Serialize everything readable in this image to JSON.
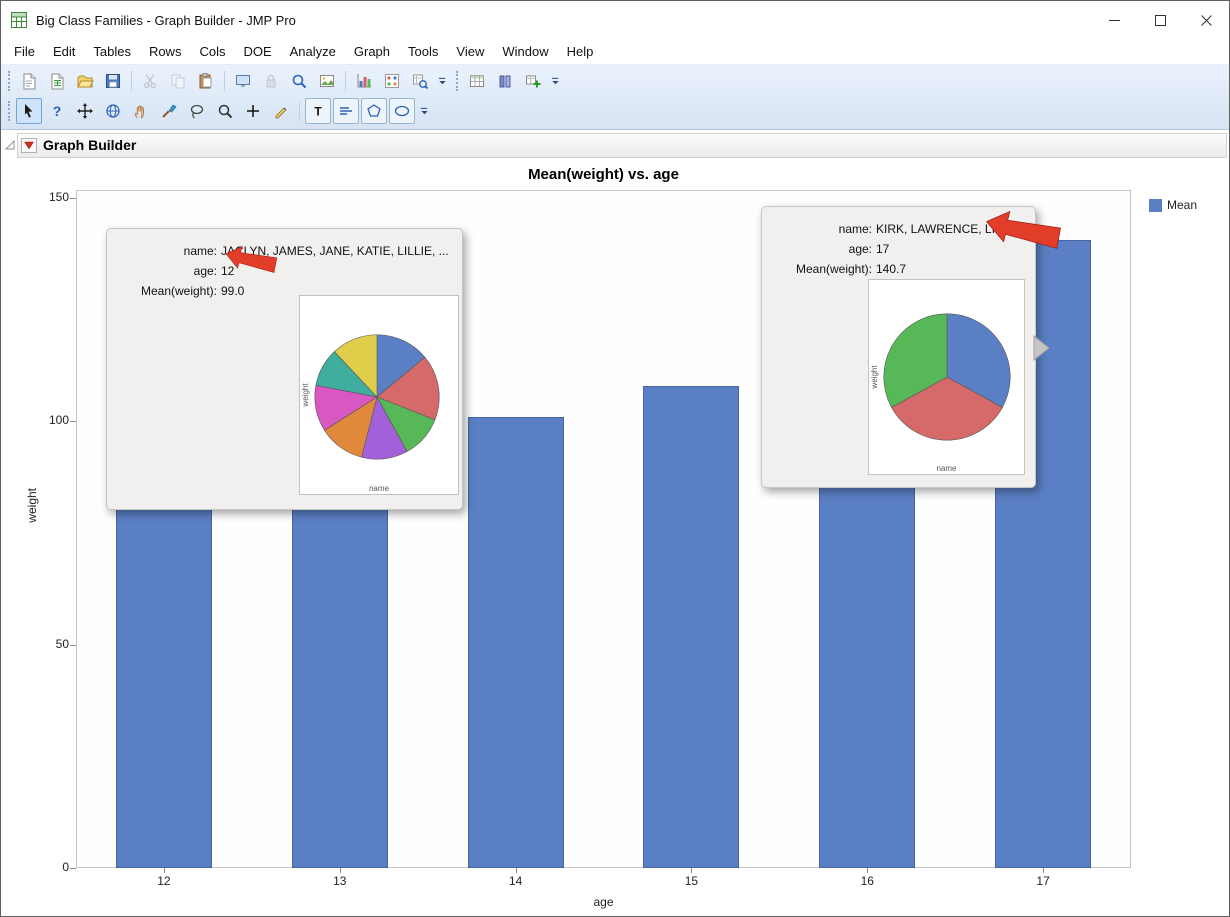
{
  "window": {
    "title": "Big Class Families - Graph Builder - JMP Pro"
  },
  "menu": {
    "items": [
      "File",
      "Edit",
      "Tables",
      "Rows",
      "Cols",
      "DOE",
      "Analyze",
      "Graph",
      "Tools",
      "View",
      "Window",
      "Help"
    ]
  },
  "toolbar": {
    "row1": [
      {
        "lead": "grip",
        "items": [
          {
            "icon": "new-journal"
          },
          {
            "icon": "new-data-table"
          },
          {
            "icon": "open"
          },
          {
            "icon": "save"
          }
        ]
      },
      {
        "lead": "sep",
        "items": [
          {
            "icon": "cut",
            "disabled": true
          },
          {
            "icon": "copy",
            "disabled": true
          },
          {
            "icon": "paste"
          }
        ]
      },
      {
        "lead": "sep",
        "items": [
          {
            "icon": "capture"
          },
          {
            "icon": "lock",
            "disabled": true
          },
          {
            "icon": "search"
          },
          {
            "icon": "picture"
          }
        ]
      },
      {
        "lead": "sep",
        "items": [
          {
            "icon": "graph-builder"
          },
          {
            "icon": "doe-design"
          },
          {
            "icon": "query"
          },
          {
            "icon": "overflow-chevron"
          }
        ]
      },
      {
        "lead": "grip",
        "items": [
          {
            "icon": "data-table"
          },
          {
            "icon": "columns-viewer"
          },
          {
            "icon": "update-table"
          },
          {
            "icon": "overflow-chevron"
          }
        ]
      }
    ],
    "row2": [
      {
        "lead": "grip",
        "items": [
          {
            "icon": "select-tool",
            "active": true
          },
          {
            "icon": "help-tool"
          },
          {
            "icon": "scroller-tool"
          },
          {
            "icon": "selection-tool"
          },
          {
            "icon": "grabber-tool"
          },
          {
            "icon": "brush-tool"
          },
          {
            "icon": "lasso-tool"
          },
          {
            "icon": "magnifier-tool"
          },
          {
            "icon": "crosshair-tool"
          },
          {
            "icon": "annotate-tool"
          }
        ]
      },
      {
        "lead": "sep",
        "items": [
          {
            "icon": "text-tool",
            "boxed": true
          },
          {
            "icon": "line-tool",
            "boxed": true
          },
          {
            "icon": "polygon-tool",
            "boxed": true
          },
          {
            "icon": "oval-tool",
            "boxed": true
          },
          {
            "icon": "overflow-chevron"
          }
        ]
      }
    ]
  },
  "panel": {
    "title": "Graph Builder"
  },
  "chart_data": {
    "type": "bar",
    "title": "Mean(weight) vs. age",
    "xlabel": "age",
    "ylabel": "weight",
    "categories": [
      "12",
      "13",
      "14",
      "15",
      "16",
      "17"
    ],
    "values": [
      99.0,
      99.0,
      101,
      108,
      118,
      140.7
    ],
    "ylim": [
      0,
      150
    ],
    "yticks": [
      0,
      50,
      100,
      150
    ],
    "grid": false,
    "legend_position": "right",
    "bar_color": "#5b7fc4",
    "legend": [
      {
        "label": "Mean",
        "color": "#5b7fc4"
      }
    ]
  },
  "tooltips": [
    {
      "rows": [
        {
          "label": "name",
          "value": "JACLYN, JAMES, JANE, KATIE, LILLIE, ..."
        },
        {
          "label": "age",
          "value": "12"
        },
        {
          "label": "Mean(weight)",
          "value": "99.0"
        }
      ],
      "pie": {
        "type": "pie",
        "ylabel": "weight",
        "xlabel": "name",
        "slices": [
          {
            "fraction": 0.14,
            "color": "#5b7fc4"
          },
          {
            "fraction": 0.17,
            "color": "#d66a6a"
          },
          {
            "fraction": 0.11,
            "color": "#57b857"
          },
          {
            "fraction": 0.12,
            "color": "#a361d9"
          },
          {
            "fraction": 0.12,
            "color": "#e0883c"
          },
          {
            "fraction": 0.12,
            "color": "#d957c0"
          },
          {
            "fraction": 0.1,
            "color": "#3fae9e"
          },
          {
            "fraction": 0.12,
            "color": "#e0ce4a"
          }
        ]
      },
      "has_drill_arrow": false
    },
    {
      "rows": [
        {
          "label": "name",
          "value": "KIRK, LAWRENCE, LINDA"
        },
        {
          "label": "age",
          "value": "17"
        },
        {
          "label": "Mean(weight)",
          "value": "140.7"
        }
      ],
      "pie": {
        "type": "pie",
        "ylabel": "weight",
        "xlabel": "name",
        "slices": [
          {
            "fraction": 0.33,
            "color": "#5b7fc4"
          },
          {
            "fraction": 0.34,
            "color": "#d66a6a"
          },
          {
            "fraction": 0.33,
            "color": "#57b857"
          }
        ]
      },
      "has_drill_arrow": true
    }
  ],
  "annotations": {
    "arrow_color": "#e23d28",
    "arrows": [
      {
        "points_at": "age: 12"
      },
      {
        "points_at": "age: 17"
      }
    ]
  }
}
